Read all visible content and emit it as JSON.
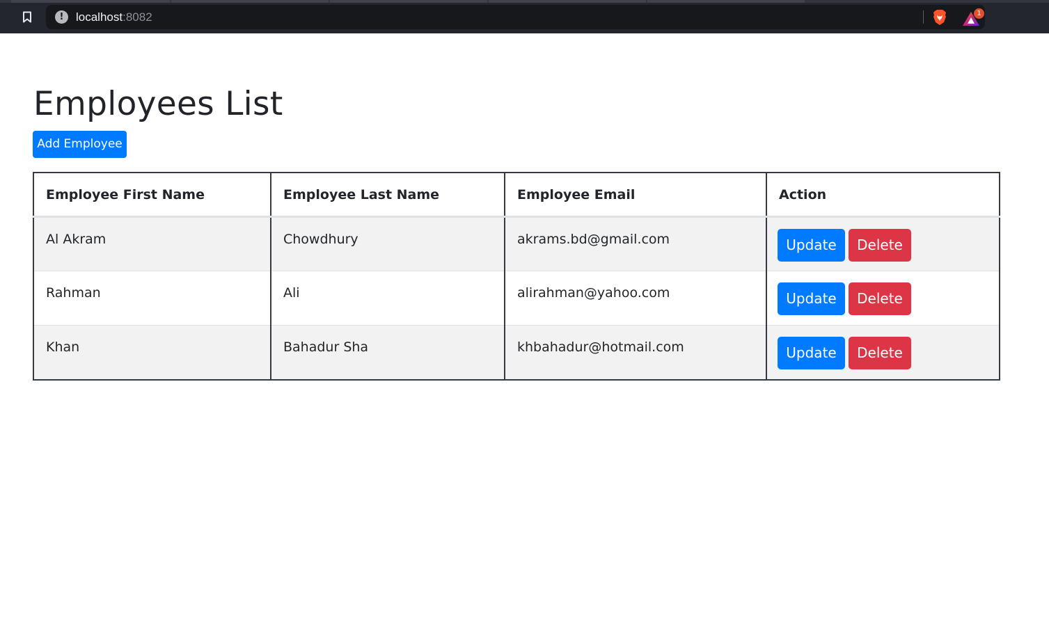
{
  "browser": {
    "url_host": "localhost",
    "url_port": ":8082",
    "rewards_badge_count": "1"
  },
  "page": {
    "title": "Employees List",
    "add_button_label": "Add Employee"
  },
  "table": {
    "headers": [
      "Employee First Name",
      "Employee Last Name",
      "Employee Email",
      "Action"
    ],
    "rows": [
      {
        "first_name": "Al Akram",
        "last_name": "Chowdhury",
        "email": "akrams.bd@gmail.com",
        "update_label": "Update",
        "delete_label": "Delete"
      },
      {
        "first_name": "Rahman",
        "last_name": "Ali",
        "email": "alirahman@yahoo.com",
        "update_label": "Update",
        "delete_label": "Delete"
      },
      {
        "first_name": "Khan",
        "last_name": "Bahadur Sha",
        "email": "khbahadur@hotmail.com",
        "update_label": "Update",
        "delete_label": "Delete"
      }
    ]
  },
  "colors": {
    "primary": "#007bff",
    "danger": "#dc3545",
    "chrome_bg": "#23252f",
    "striped_row": "#f2f2f2",
    "table_border": "#343a40"
  },
  "icons": {
    "bookmark": "bookmark-icon",
    "site_info": "info-icon",
    "brave_shields": "brave-lion-icon",
    "brave_rewards": "rewards-triangle-icon"
  }
}
